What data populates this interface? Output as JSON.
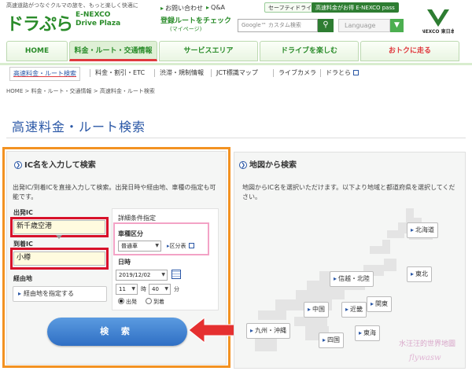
{
  "header": {
    "tagline": "高速道路がつなぐクルマの旅を、もっと楽しく快適に",
    "logo_ja": "ドラぷら",
    "logo_en_1": "E-NEXCO",
    "logo_en_2": "Drive Plaza",
    "util_links": [
      "お問い合わせ",
      "Q&A"
    ],
    "pills": [
      "セーフティドライブ",
      "高速料金がお得 E-NEXCO pass"
    ],
    "check_route": "登録ルートをチェック",
    "check_route_sub": "(マイページ)",
    "search_placeholder": "Google™ カスタム検索",
    "language_label": "Language",
    "nexco_label": "NEXCO 東日本"
  },
  "main_nav": [
    {
      "label": "HOME"
    },
    {
      "label": "料金・ルート・交通情報"
    },
    {
      "label": "サービスエリア"
    },
    {
      "label": "ドライブを楽しむ"
    },
    {
      "label": "おトクに走る"
    }
  ],
  "sub_nav": [
    {
      "label": "高速料金・ルート検索"
    },
    {
      "label": "料金・割引・ETC"
    },
    {
      "label": "渋滞・規制情報"
    },
    {
      "label": "JCT標識マップ"
    },
    {
      "label": "ライブカメラ"
    },
    {
      "label": "ドラとら"
    }
  ],
  "breadcrumb": "HOME  >  料金・ルート・交通情報  >  高速料金・ルート検索",
  "page_title": "高速料金・ルート検索",
  "ic_search": {
    "title": "IC名を入力して検索",
    "description": "出発IC/到着ICを直接入力して検索。出発日時や経由地、車種の指定も可能です。",
    "depart_label": "出発IC",
    "depart_value": "新千歳空港",
    "arrive_label": "到着IC",
    "arrive_value": "小樽",
    "via_label": "経由地",
    "via_button": "経由地を指定する",
    "detail_title": "詳細条件指定",
    "vehicle_label": "車種区分",
    "vehicle_value": "普通車",
    "vehicle_link": "区分表",
    "datetime_label": "日時",
    "date_value": "2019/12/02",
    "hour_value": "11",
    "hour_unit": "時",
    "minute_value": "40",
    "minute_unit": "分",
    "radio_depart": "出発",
    "radio_arrive": "到着",
    "search_button": "検 索"
  },
  "map_search": {
    "title": "地図から検索",
    "description": "地図からIC名を選択いただけます。以下より地域と都道府県を選択してください。",
    "regions": [
      "北海道",
      "東北",
      "信越・北陸",
      "関東",
      "中国",
      "近畿",
      "九州・沖縄",
      "東海",
      "四国"
    ]
  },
  "watermark": "水汪汪的世界地圖",
  "watermark_sign": "flywasw",
  "colors": {
    "brand_green": "#2a8c2a",
    "title_blue": "#2a57a6",
    "highlight_red": "#d8112a",
    "highlight_orange": "#f39222",
    "highlight_pink": "#f3a3c6",
    "button_blue": "#2f6fc4"
  }
}
